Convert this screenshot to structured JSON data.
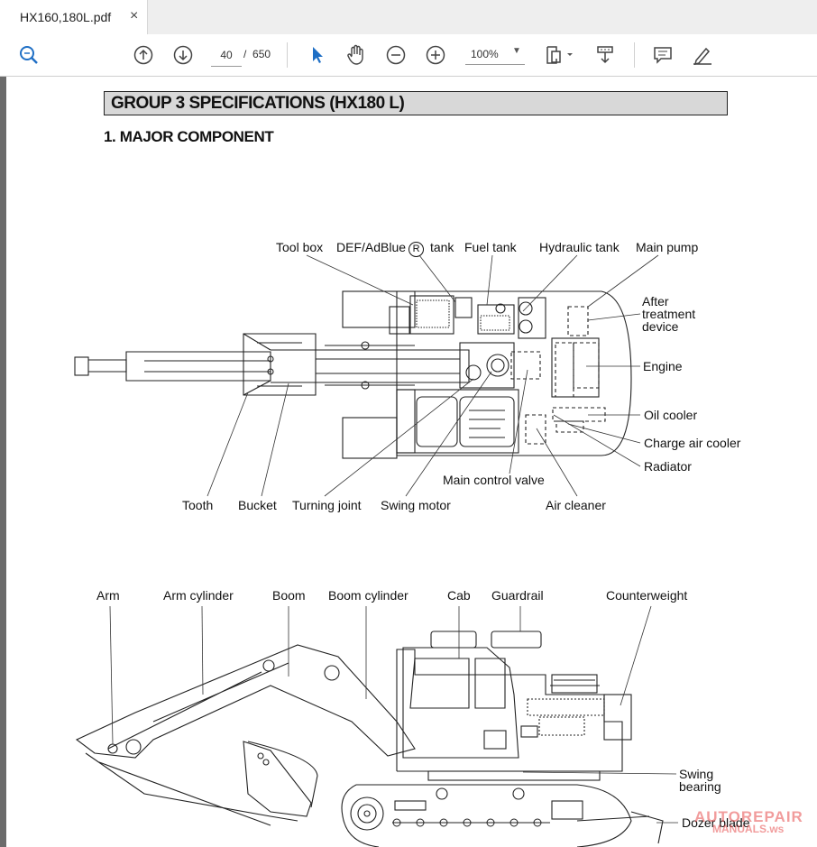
{
  "tab": {
    "title": "HX160,180L.pdf",
    "close": "×"
  },
  "toolbar": {
    "page_current": "40",
    "page_separator": "/",
    "page_total": "650",
    "zoom": "100%",
    "icons": [
      "search-icon",
      "prev-page-icon",
      "next-page-icon",
      "select-cursor-icon",
      "hand-tool-icon",
      "zoom-out-icon",
      "zoom-in-icon",
      "fit-page-icon",
      "rotate-icon",
      "comment-icon",
      "draw-icon"
    ]
  },
  "document": {
    "group_title": "GROUP 3 SPECIFICATIONS (HX180 L)",
    "section_title": "1. MAJOR COMPONENT",
    "top_labels": {
      "tool_box": "Tool box",
      "def_tank_a": "DEF/AdBlue",
      "def_tank_mark": "R",
      "def_tank_b": "tank",
      "fuel_tank": "Fuel tank",
      "hydraulic_tank": "Hydraulic tank",
      "main_pump": "Main pump",
      "after_treatment": "After treatment device",
      "engine": "Engine",
      "oil_cooler": "Oil cooler",
      "charge_air_cooler": "Charge air cooler",
      "radiator": "Radiator",
      "main_control_valve": "Main control valve",
      "tooth": "Tooth",
      "bucket": "Bucket",
      "turning_joint": "Turning joint",
      "swing_motor": "Swing motor",
      "air_cleaner": "Air cleaner"
    },
    "side_labels": {
      "arm": "Arm",
      "arm_cylinder": "Arm cylinder",
      "boom": "Boom",
      "boom_cylinder": "Boom cylinder",
      "cab": "Cab",
      "guardrail": "Guardrail",
      "counterweight": "Counterweight",
      "swing_bearing": "Swing bearing",
      "dozer_blade": "Dozer blade"
    }
  },
  "watermark": {
    "line1": "AUTOREPAIR",
    "line2": "MANUALS.ws"
  }
}
